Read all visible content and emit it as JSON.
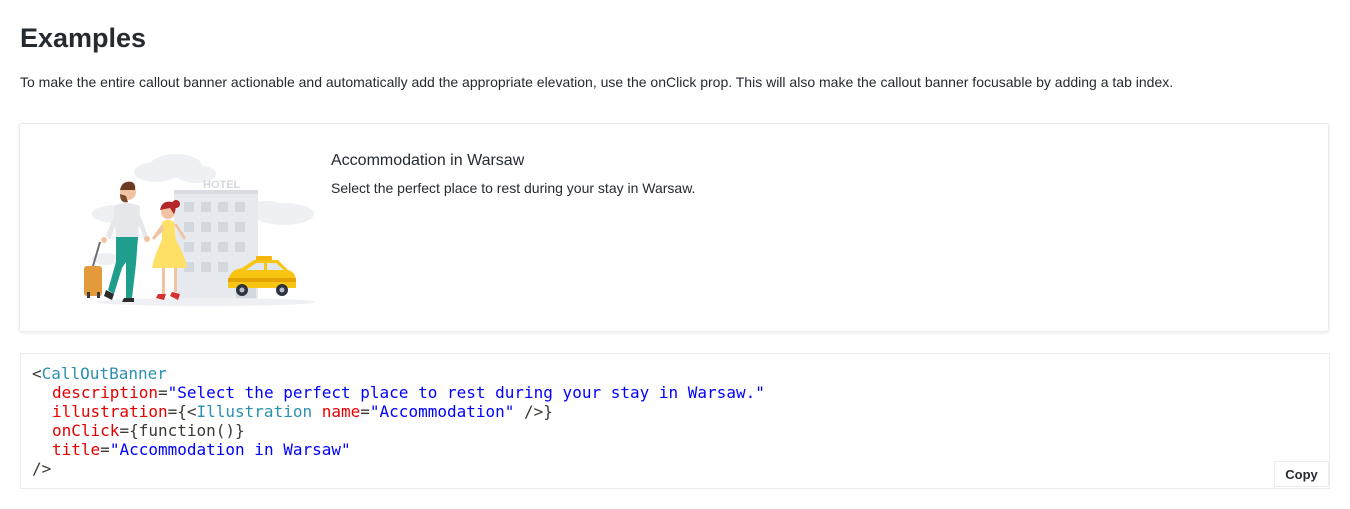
{
  "page": {
    "title": "Examples",
    "intro": "To make the entire callout banner actionable and automatically add the appropriate elevation, use the onClick prop. This will also make the callout banner focusable by adding a tab index."
  },
  "banner": {
    "title": "Accommodation in Warsaw",
    "description": "Select the perfect place to rest during your stay in Warsaw.",
    "illustration": {
      "name": "accommodation-illustration",
      "hotel_sign": "HOTEL"
    }
  },
  "code": {
    "open_bracket": "<",
    "component": "CallOutBanner",
    "description_attr": "description",
    "description_value": "\"Select the perfect place to rest during your stay in Warsaw.\"",
    "illustration_attr": "illustration",
    "illustration_open": "={<",
    "illustration_component": "Illustration",
    "name_attr": "name",
    "name_value": "\"Accommodation\"",
    "illustration_close": " />}",
    "onclick_attr": "onClick",
    "onclick_value": "={function()}",
    "title_attr": "title",
    "title_value": "\"Accommodation in Warsaw\"",
    "close": "/>",
    "equals": "=",
    "copy_label": "Copy"
  },
  "colors": {
    "text": "#252a31",
    "tag": "#2b91af",
    "attribute": "#e50000",
    "string": "#0000ff",
    "border": "#e8edf1"
  }
}
